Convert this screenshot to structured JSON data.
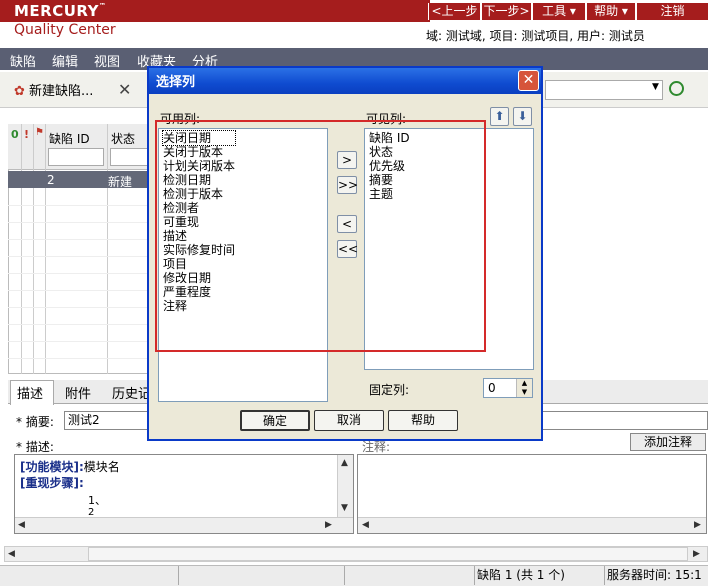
{
  "header": {
    "brand": "MERCURY",
    "brand_tm": "™",
    "product": "Quality Center",
    "prev": "<上一步",
    "next": "下一步>",
    "tools": "工具 ▾",
    "help": "帮助 ▾",
    "logout": "注销",
    "context": "域: 测试域, 项目: 测试项目, 用户: 测试员"
  },
  "menubar": [
    "缺陷",
    "编辑",
    "视图",
    "收藏夹",
    "分析"
  ],
  "toolbar": {
    "new_defect": "新建缺陷...",
    "close": "✕"
  },
  "grid": {
    "col_id": "缺陷 ID",
    "col_status": "状态",
    "row": {
      "id": "2",
      "status": "新建"
    }
  },
  "details": {
    "tabs": [
      "描述",
      "附件",
      "历史记"
    ],
    "summary_label": "* 摘要:",
    "summary_value": "测试2",
    "desc_label": "* 描述:",
    "comment_label": "注释:",
    "add_comment": "添加注释",
    "desc_lines": [
      {
        "key": "[功能模块]:",
        "val": "模块名"
      },
      {
        "key": "[重现步骤]:",
        "val": ""
      },
      {
        "key": "",
        "val": "1、"
      },
      {
        "key": "",
        "val": "2"
      }
    ]
  },
  "status_bar": {
    "defect_count": "缺陷 1 (共 1 个)",
    "server_time": "服务器时间: 15:1"
  },
  "dialog": {
    "title": "选择列",
    "available_label": "可用列:",
    "visible_label": "可见列:",
    "available": [
      "关闭日期",
      "关闭于版本",
      "计划关闭版本",
      "检测日期",
      "检测于版本",
      "检测者",
      "可重现",
      "描述",
      "实际修复时间",
      "项目",
      "修改日期",
      "严重程度",
      "注释"
    ],
    "visible": [
      "缺陷 ID",
      "状态",
      "优先级",
      "摘要",
      "主题"
    ],
    "btn_add": ">",
    "btn_add_all": ">>",
    "btn_remove": "<",
    "btn_remove_all": "<<",
    "fixed_label": "固定列:",
    "fixed_value": "0",
    "ok": "确定",
    "cancel": "取消",
    "help": "帮助"
  },
  "colors": {
    "brand_red": "#a51d1d",
    "menubar": "#5a5f73",
    "dialog_title": "#0f4bd0",
    "highlight": "#d42a2a"
  }
}
